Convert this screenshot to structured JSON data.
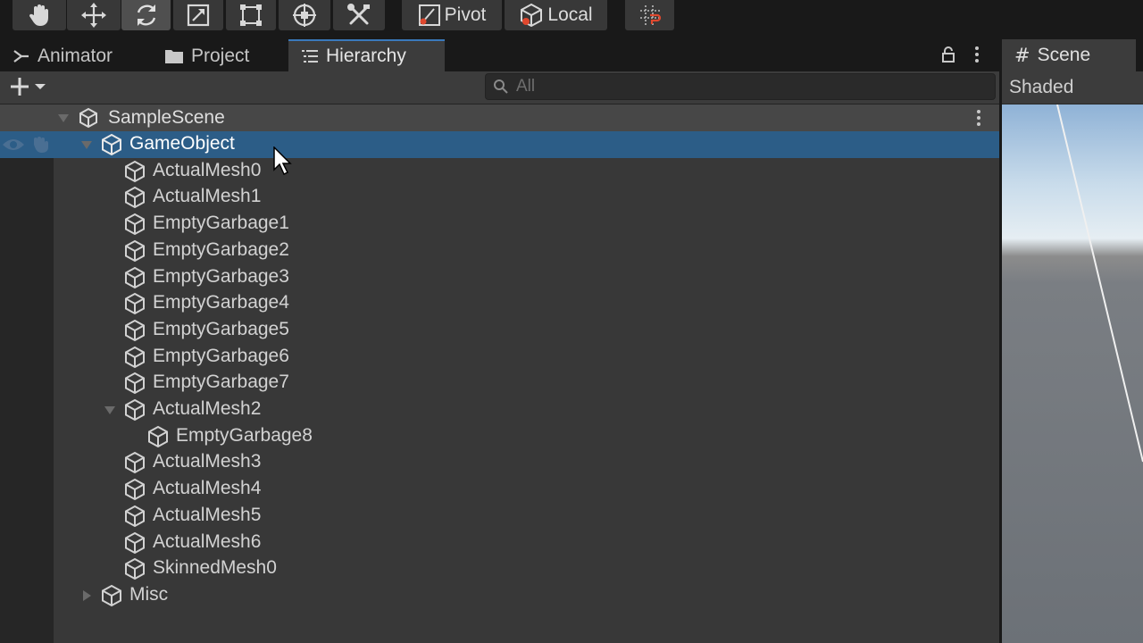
{
  "toolbar": {
    "tools": [
      {
        "name": "hand-tool",
        "icon": "hand-icon"
      },
      {
        "name": "move-tool",
        "icon": "move-arrows-icon"
      },
      {
        "name": "rotate-tool",
        "icon": "rotate-icon",
        "active": true
      },
      {
        "name": "scale-tool",
        "icon": "scale-icon"
      },
      {
        "name": "rect-tool",
        "icon": "rect-transform-icon"
      },
      {
        "name": "transform-tool",
        "icon": "transform-icon"
      },
      {
        "name": "custom-tool",
        "icon": "tools-icon"
      }
    ],
    "pivot_label": "Pivot",
    "local_label": "Local"
  },
  "tabs": {
    "animator": "Animator",
    "project": "Project",
    "hierarchy": "Hierarchy",
    "scene": "Scene"
  },
  "search": {
    "placeholder": "All"
  },
  "hierarchy": {
    "scene_name": "SampleScene",
    "items": [
      {
        "label": "GameObject",
        "depth": 0,
        "expanded": true,
        "selected": true
      },
      {
        "label": "ActualMesh0",
        "depth": 1
      },
      {
        "label": "ActualMesh1",
        "depth": 1
      },
      {
        "label": "EmptyGarbage1",
        "depth": 1
      },
      {
        "label": "EmptyGarbage2",
        "depth": 1
      },
      {
        "label": "EmptyGarbage3",
        "depth": 1
      },
      {
        "label": "EmptyGarbage4",
        "depth": 1
      },
      {
        "label": "EmptyGarbage5",
        "depth": 1
      },
      {
        "label": "EmptyGarbage6",
        "depth": 1
      },
      {
        "label": "EmptyGarbage7",
        "depth": 1
      },
      {
        "label": "ActualMesh2",
        "depth": 1,
        "expanded": true
      },
      {
        "label": "EmptyGarbage8",
        "depth": 2
      },
      {
        "label": "ActualMesh3",
        "depth": 1
      },
      {
        "label": "ActualMesh4",
        "depth": 1
      },
      {
        "label": "ActualMesh5",
        "depth": 1
      },
      {
        "label": "ActualMesh6",
        "depth": 1
      },
      {
        "label": "SkinnedMesh0",
        "depth": 1
      },
      {
        "label": "Misc",
        "depth": 0,
        "expanded": false
      }
    ]
  },
  "scene_view": {
    "shading_mode": "Shaded"
  },
  "colors": {
    "selection": "#2c5d87",
    "accent": "#3a79bb"
  }
}
